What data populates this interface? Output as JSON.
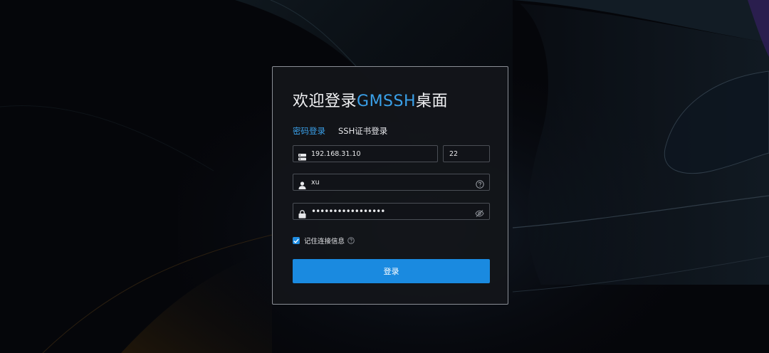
{
  "title": {
    "prefix": "欢迎登录",
    "accent": "GMSSH",
    "suffix": "桌面"
  },
  "tabs": [
    {
      "label": "密码登录",
      "active": true
    },
    {
      "label": "SSH证书登录",
      "active": false
    }
  ],
  "form": {
    "host": "192.168.31.10",
    "port": "22",
    "username": "xu",
    "password": "•••••••••••••••••"
  },
  "remember": {
    "label": "记住连接信息",
    "checked": true
  },
  "login_button": {
    "label": "登录"
  },
  "icons": {
    "host": "server-icon",
    "user": "user-icon",
    "password": "lock-icon",
    "help": "help-circle-icon",
    "visibility": "eye-off-icon",
    "checkbox": "check-icon"
  },
  "colors": {
    "accent": "#3aa0e8",
    "button": "#1a8ae0",
    "panel": "#13151a",
    "background": "#05060a"
  }
}
